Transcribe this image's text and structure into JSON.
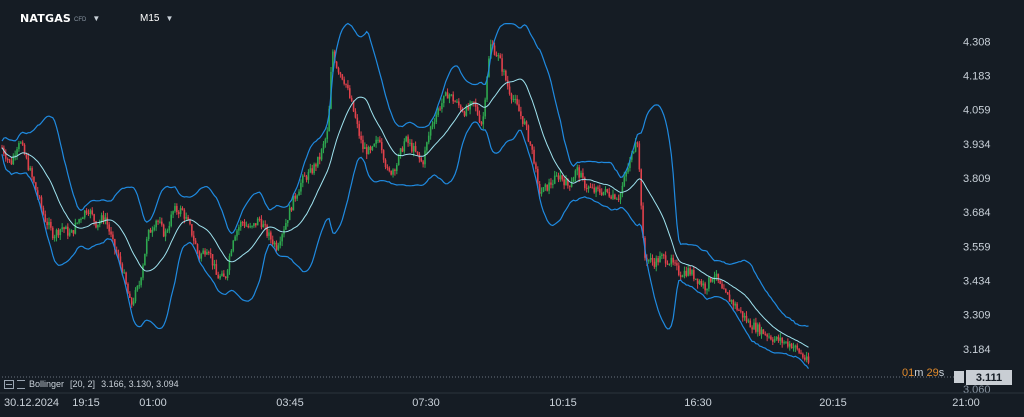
{
  "instrument": {
    "symbol": "NATGAS",
    "type_tag": "CFD"
  },
  "timeframe": {
    "label": "M15"
  },
  "indicator": {
    "name": "Bollinger",
    "params": "[20,  2]",
    "values": "3.166,  3.130,  3.094"
  },
  "countdown": {
    "minutes": "01",
    "m_unit": "m",
    "seconds": "29",
    "s_unit": "s"
  },
  "current_price": "3.111",
  "partially_visible_tick": "3.060",
  "colors": {
    "background": "#151c24",
    "up_candle": "#2ea84f",
    "down_candle": "#e0414b",
    "bollinger_band": "#1f8ae0",
    "bollinger_mid": "#9fe3ef",
    "accent_timer": "#e08a2c"
  },
  "chart_data": {
    "type": "candlestick",
    "title": "",
    "xlabel": "",
    "ylabel": "",
    "y_axis_position": "right",
    "ylim": [
      3.07,
      4.35
    ],
    "y_ticks": [
      "4.308",
      "4.183",
      "4.059",
      "3.934",
      "3.809",
      "3.684",
      "3.559",
      "3.434",
      "3.309",
      "3.184"
    ],
    "x_ticks": [
      "30.12.2024",
      "19:15",
      "01:00",
      "03:45",
      "07:30",
      "10:15",
      "16:30",
      "20:15",
      "21:00"
    ],
    "grid": false,
    "series": [
      {
        "name": "Bollinger",
        "params": [
          20,
          2
        ]
      }
    ],
    "price_path": [
      [
        0,
        3.92
      ],
      [
        0.01,
        3.86
      ],
      [
        0.02,
        3.95
      ],
      [
        0.03,
        3.86
      ],
      [
        0.04,
        3.76
      ],
      [
        0.05,
        3.66
      ],
      [
        0.06,
        3.6
      ],
      [
        0.07,
        3.63
      ],
      [
        0.08,
        3.6
      ],
      [
        0.09,
        3.66
      ],
      [
        0.1,
        3.7
      ],
      [
        0.11,
        3.64
      ],
      [
        0.12,
        3.67
      ],
      [
        0.13,
        3.56
      ],
      [
        0.14,
        3.48
      ],
      [
        0.15,
        3.34
      ],
      [
        0.16,
        3.42
      ],
      [
        0.17,
        3.6
      ],
      [
        0.18,
        3.66
      ],
      [
        0.19,
        3.6
      ],
      [
        0.2,
        3.69
      ],
      [
        0.21,
        3.69
      ],
      [
        0.22,
        3.62
      ],
      [
        0.23,
        3.52
      ],
      [
        0.24,
        3.56
      ],
      [
        0.25,
        3.45
      ],
      [
        0.26,
        3.44
      ],
      [
        0.27,
        3.6
      ],
      [
        0.28,
        3.65
      ],
      [
        0.29,
        3.62
      ],
      [
        0.3,
        3.66
      ],
      [
        0.31,
        3.6
      ],
      [
        0.32,
        3.56
      ],
      [
        0.33,
        3.64
      ],
      [
        0.34,
        3.73
      ],
      [
        0.35,
        3.8
      ],
      [
        0.36,
        3.83
      ],
      [
        0.37,
        3.88
      ],
      [
        0.38,
        3.98
      ],
      [
        0.385,
        4.28
      ],
      [
        0.39,
        4.22
      ],
      [
        0.4,
        4.16
      ],
      [
        0.41,
        4.05
      ],
      [
        0.42,
        3.92
      ],
      [
        0.43,
        3.9
      ],
      [
        0.44,
        3.96
      ],
      [
        0.45,
        3.82
      ],
      [
        0.46,
        3.86
      ],
      [
        0.47,
        3.95
      ],
      [
        0.48,
        3.91
      ],
      [
        0.49,
        3.86
      ],
      [
        0.5,
        4.0
      ],
      [
        0.51,
        4.07
      ],
      [
        0.52,
        4.12
      ],
      [
        0.53,
        4.08
      ],
      [
        0.54,
        4.05
      ],
      [
        0.55,
        4.08
      ],
      [
        0.56,
        4.0
      ],
      [
        0.565,
        4.18
      ],
      [
        0.57,
        4.3
      ],
      [
        0.58,
        4.24
      ],
      [
        0.59,
        4.14
      ],
      [
        0.6,
        4.07
      ],
      [
        0.61,
        4.0
      ],
      [
        0.62,
        3.88
      ],
      [
        0.625,
        3.76
      ],
      [
        0.63,
        3.76
      ],
      [
        0.64,
        3.79
      ],
      [
        0.65,
        3.82
      ],
      [
        0.66,
        3.78
      ],
      [
        0.67,
        3.84
      ],
      [
        0.68,
        3.78
      ],
      [
        0.69,
        3.76
      ],
      [
        0.7,
        3.76
      ],
      [
        0.71,
        3.75
      ],
      [
        0.72,
        3.74
      ],
      [
        0.725,
        3.8
      ],
      [
        0.735,
        3.9
      ],
      [
        0.74,
        3.98
      ],
      [
        0.745,
        3.72
      ],
      [
        0.748,
        3.52
      ],
      [
        0.76,
        3.5
      ],
      [
        0.77,
        3.52
      ],
      [
        0.78,
        3.5
      ],
      [
        0.79,
        3.46
      ],
      [
        0.8,
        3.47
      ],
      [
        0.81,
        3.44
      ],
      [
        0.82,
        3.41
      ],
      [
        0.83,
        3.46
      ],
      [
        0.84,
        3.39
      ],
      [
        0.85,
        3.36
      ],
      [
        0.86,
        3.32
      ],
      [
        0.87,
        3.28
      ],
      [
        0.88,
        3.26
      ],
      [
        0.89,
        3.24
      ],
      [
        0.9,
        3.22
      ],
      [
        0.91,
        3.21
      ],
      [
        0.92,
        3.2
      ],
      [
        0.93,
        3.17
      ],
      [
        0.94,
        3.13
      ]
    ],
    "last_value": 3.111
  }
}
